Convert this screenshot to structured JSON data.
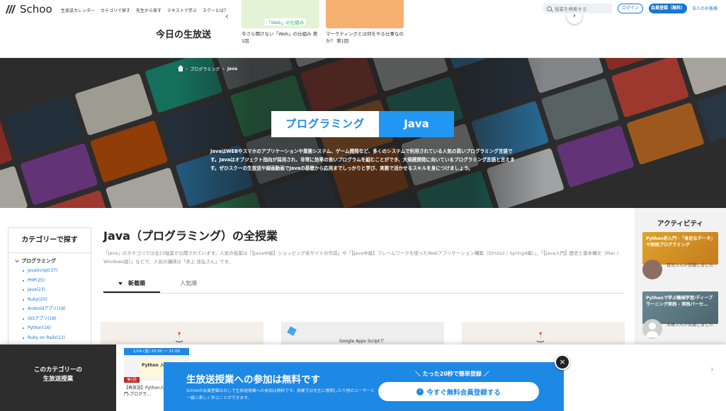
{
  "header": {
    "logo": "Schoo",
    "nav": [
      "生放送カレンダー",
      "カテゴリで探す",
      "先生から探す",
      "テキストで学ぶ",
      "スクーとは？"
    ],
    "today_label": "今日の生放送",
    "lessons": [
      {
        "thumb_text": "「Web」の仕組み",
        "title": "今さら聞けない「Web」の仕組み 第1回",
        "color": "#e4f2d6"
      },
      {
        "thumb_text": "",
        "title": "マーケティングとは何をやる仕事なのか？ 第1回",
        "color": "#f6b06f"
      }
    ],
    "search_placeholder": "授業を検索する",
    "login": "ログイン",
    "signup": "会員登録（無料）",
    "corporate": "法人のお客様"
  },
  "hero": {
    "breadcrumb": [
      "プログラミング",
      "Java"
    ],
    "tag_parent": "プログラミング",
    "tag_child": "Java",
    "description": "JavaはWEBやスマホのアプリケーションや業務システム、ゲーム開発など、多くのシステムで利用されている人気の高いプログラミング言語です。Javaはオブジェクト指向が採用され、非常に効率の良いプログラムを組むことができ、大規模開発に向いているプログラミング言語と言えます。ぜひスクーの生放送や録画動画でJavaの基礎から応用までしっかりと学び、実務で活かせるスキルを身につけましょう。"
  },
  "sidebar": {
    "title": "カテゴリーで探す",
    "group": "プログラミング",
    "items": [
      "JavaScript(37)",
      "PHP(25)",
      "Java(23)",
      "Ruby(20)",
      "Androidアプリ(18)",
      "iOSアプリ(18)",
      "Python(16)",
      "Ruby on Rails(13)"
    ]
  },
  "main": {
    "title": "Java（プログラミング）の全授業",
    "description": "「Java」のカテゴリでは全23授業が公開されています。人気の授業は「【Java中級】ショッピング系サイトの作成」や「【Java中級】フレームワークを使ったWebアプリケーション構築（Struts2 / Spring4編）」、「【Java入門】歴史と基本構文（Mac / Windows版）」などで、人気の講師は「井上 佳弘さん」です。",
    "tabs": [
      "新着順",
      "人気順"
    ],
    "card_text": "Google Apps Scriptで"
  },
  "activity": {
    "title": "アクティビティ",
    "cards": [
      {
        "text": "Python初入門 -「身近なデータ」で実践プログラミング",
        "user": "青司さんが受講しました",
        "color": "#e0a42a"
      },
      {
        "text": "Pythonで学ぶ機械学習/ディープラーニング実践 - 実践パーセ…",
        "user": "玉穂さんが受講しました",
        "color": "#6b8a94"
      }
    ]
  },
  "bottom": {
    "left_label_1": "このカテゴリーの",
    "left_label_2": "生放送授業",
    "mini_date": "1/14 (金) 20:00 ～ 21:00",
    "mini_thumb": "Python 入門",
    "mini_badge": "第1回",
    "mini_title": "【再放送】Python入門-プログラ…",
    "promo_title": "生放送授業への参加は無料です",
    "promo_sub": "Schooの会員登録はなしで生放送授業への参加は無料です。授業では先生に質問したり他のユーザーと一緒に楽しく学ぶことができます。",
    "promo_lead": "＼ たった20秒で簡単登録 ／",
    "promo_button": "今すぐ無料会員登録する",
    "close": "×"
  },
  "colors": {
    "brand_blue": "#1e88e5",
    "link_blue": "#1976d2",
    "promo_blue": "#1e88e5",
    "dark_panel": "#2d2d2d"
  }
}
